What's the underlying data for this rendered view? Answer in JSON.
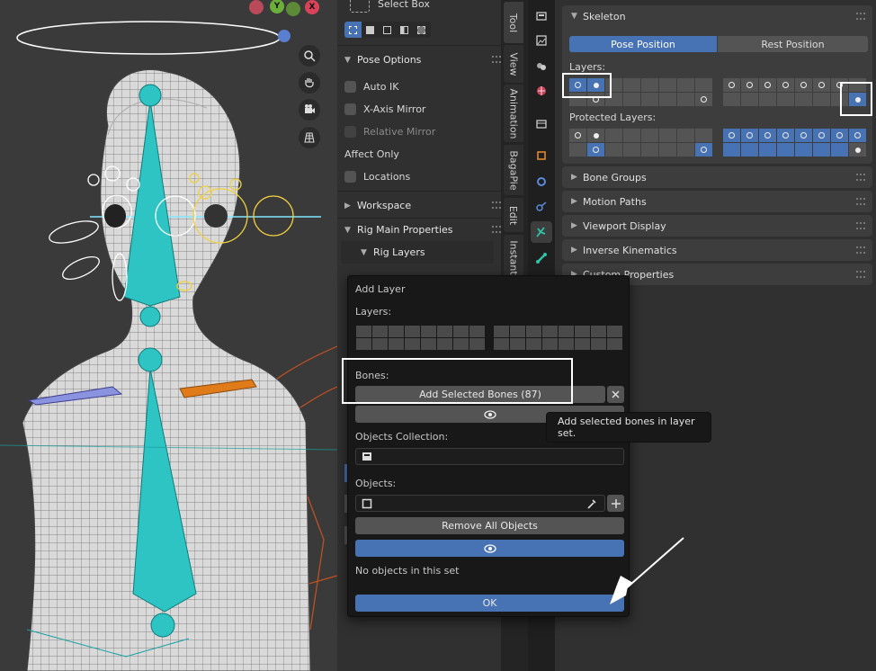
{
  "tool_panel": {
    "select_box_label": "Select Box",
    "pose_options_header": "Pose Options",
    "auto_ik": "Auto IK",
    "x_axis_mirror": "X-Axis Mirror",
    "relative_mirror": "Relative Mirror",
    "affect_only": "Affect Only",
    "locations": "Locations",
    "workspace": "Workspace",
    "rig_main_properties": "Rig Main Properties",
    "rig_layers": "Rig Layers"
  },
  "tabs": [
    "Tool",
    "View",
    "Animation",
    "BagaPie",
    "Edit",
    "Instant"
  ],
  "skeleton": {
    "header": "Skeleton",
    "pose_position": "Pose Position",
    "rest_position": "Rest Position",
    "layers_label": "Layers:",
    "protected_layers_label": "Protected Layers:"
  },
  "collapsed_panels": [
    "Bone Groups",
    "Motion Paths",
    "Viewport Display",
    "Inverse Kinematics",
    "Custom Properties"
  ],
  "dialog": {
    "title": "Add Layer",
    "layers_label": "Layers:",
    "bones_label": "Bones:",
    "add_selected_bones": "Add Selected Bones (87)",
    "objects_collection_label": "Objects Collection:",
    "objects_label": "Objects:",
    "remove_all_objects": "Remove All Objects",
    "no_objects": "No objects in this set",
    "ok": "OK"
  },
  "tooltip": "Add selected bones in layer set.",
  "gizmo": {
    "y": "Y",
    "x": "X"
  },
  "colors": {
    "accent": "#4772b3",
    "bone_cyan": "#2ec4c4",
    "bone_orange": "#e07b1a",
    "bone_blue": "#7b86d9"
  }
}
